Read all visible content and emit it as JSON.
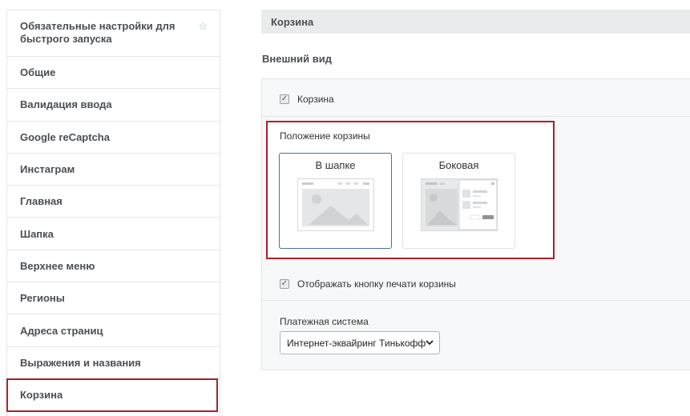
{
  "sidebar": {
    "items": [
      {
        "label": "Обязательные настройки для быстрого запуска",
        "starred": true
      },
      {
        "label": "Общие"
      },
      {
        "label": "Валидация ввода"
      },
      {
        "label": "Google reCaptcha"
      },
      {
        "label": "Инстаграм"
      },
      {
        "label": "Главная"
      },
      {
        "label": "Шапка"
      },
      {
        "label": "Верхнее меню"
      },
      {
        "label": "Регионы"
      },
      {
        "label": "Адреса страниц"
      },
      {
        "label": "Выражения и названия"
      },
      {
        "label": "Корзина",
        "active": true
      }
    ],
    "star_glyph": "☆"
  },
  "main": {
    "section_title": "Корзина",
    "subtitle": "Внешний вид",
    "cart_checkbox": {
      "label": "Корзина",
      "checked": true
    },
    "cart_position": {
      "label": "Положение корзины",
      "options": [
        {
          "label": "В шапке",
          "selected": true
        },
        {
          "label": "Боковая",
          "selected": false
        }
      ]
    },
    "print_checkbox": {
      "label": "Отображать кнопку печати корзины",
      "checked": true
    },
    "payment": {
      "label": "Платежная система",
      "selected": "Интернет-эквайринг Тинькофф"
    }
  },
  "colors": {
    "highlight_border": "#a8232b",
    "selected_card_border": "#4a6fa0",
    "header_bg": "#e8eced"
  }
}
